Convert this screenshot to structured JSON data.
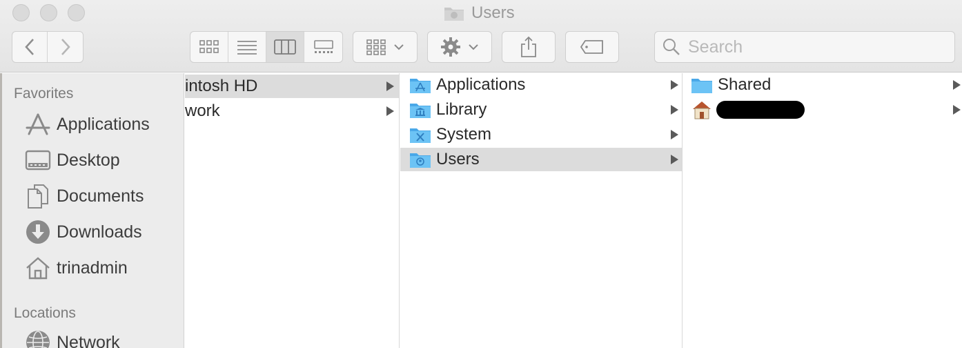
{
  "window": {
    "title": "Users"
  },
  "toolbar": {
    "back_icon": "chevron-left-icon",
    "forward_icon": "chevron-right-icon",
    "views": [
      "icon-view",
      "list-view",
      "column-view",
      "gallery-view"
    ],
    "active_view": "column-view",
    "arrange_icon": "arrange-grid-icon",
    "action_icon": "gear-icon",
    "share_icon": "share-icon",
    "tag_icon": "tag-icon"
  },
  "search": {
    "placeholder": "Search",
    "value": ""
  },
  "sidebar": {
    "favorites_heading": "Favorites",
    "favorites": [
      {
        "label": "Applications",
        "icon": "applications-icon"
      },
      {
        "label": "Desktop",
        "icon": "desktop-icon"
      },
      {
        "label": "Documents",
        "icon": "documents-icon"
      },
      {
        "label": "Downloads",
        "icon": "downloads-icon"
      },
      {
        "label": "trinadmin",
        "icon": "home-icon"
      }
    ],
    "locations_heading": "Locations",
    "locations": [
      {
        "label": "Network",
        "icon": "network-icon"
      }
    ]
  },
  "columns": {
    "col1": [
      {
        "label": "intosh HD",
        "selected": true
      },
      {
        "label": "work",
        "selected": false
      }
    ],
    "col2": [
      {
        "label": "Applications",
        "icon": "applications-folder-icon",
        "selected": false
      },
      {
        "label": "Library",
        "icon": "library-folder-icon",
        "selected": false
      },
      {
        "label": "System",
        "icon": "system-folder-icon",
        "selected": false
      },
      {
        "label": "Users",
        "icon": "users-folder-icon",
        "selected": true
      }
    ],
    "col3": [
      {
        "label": "Shared",
        "icon": "folder-icon"
      },
      {
        "label": "",
        "icon": "home-icon",
        "redacted": true
      }
    ]
  },
  "colors": {
    "folder_blue": "#5cb8f0",
    "selection": "#dcdcdc",
    "sidebar_bg": "#ececec"
  }
}
